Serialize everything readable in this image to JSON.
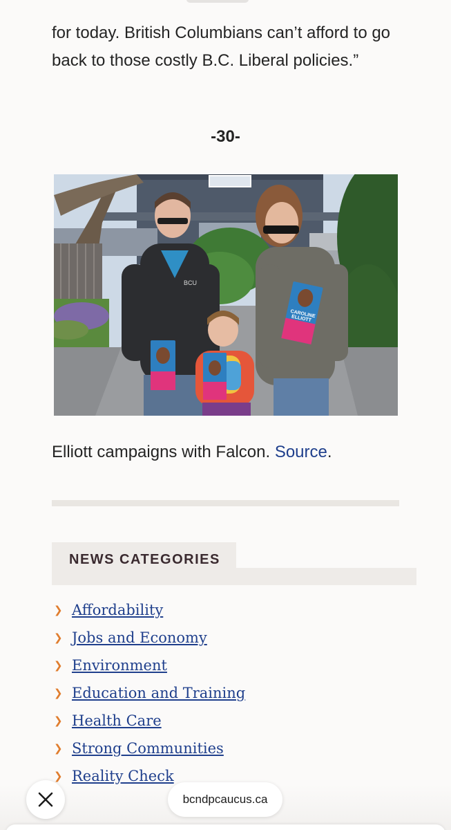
{
  "article": {
    "quote_text": "for today. British Columbians can’t afford to go back to those costly B.C. Liberal policies.”",
    "end_mark": "-30-"
  },
  "photo": {
    "caption_text": "Elliott campaigns with Falcon.",
    "caption_link": "Source",
    "caption_end": ".",
    "flyer_lines": [
      "CAROLINE",
      "ELLIOTT"
    ],
    "jacket_logo": "BCU"
  },
  "categories": {
    "heading": "NEWS CATEGORIES",
    "items": [
      {
        "label": "Affordability"
      },
      {
        "label": "Jobs and Economy"
      },
      {
        "label": "Environment"
      },
      {
        "label": "Education and Training"
      },
      {
        "label": "Health Care"
      },
      {
        "label": "Strong Communities"
      },
      {
        "label": "Reality Check"
      }
    ]
  },
  "browser": {
    "url": "bcndpcaucus.ca",
    "close_icon": "close-icon"
  },
  "colors": {
    "link": "#1f3f8c",
    "chevron": "#e07d2e",
    "heading": "#3a2a2f",
    "band": "#eeebe8"
  }
}
